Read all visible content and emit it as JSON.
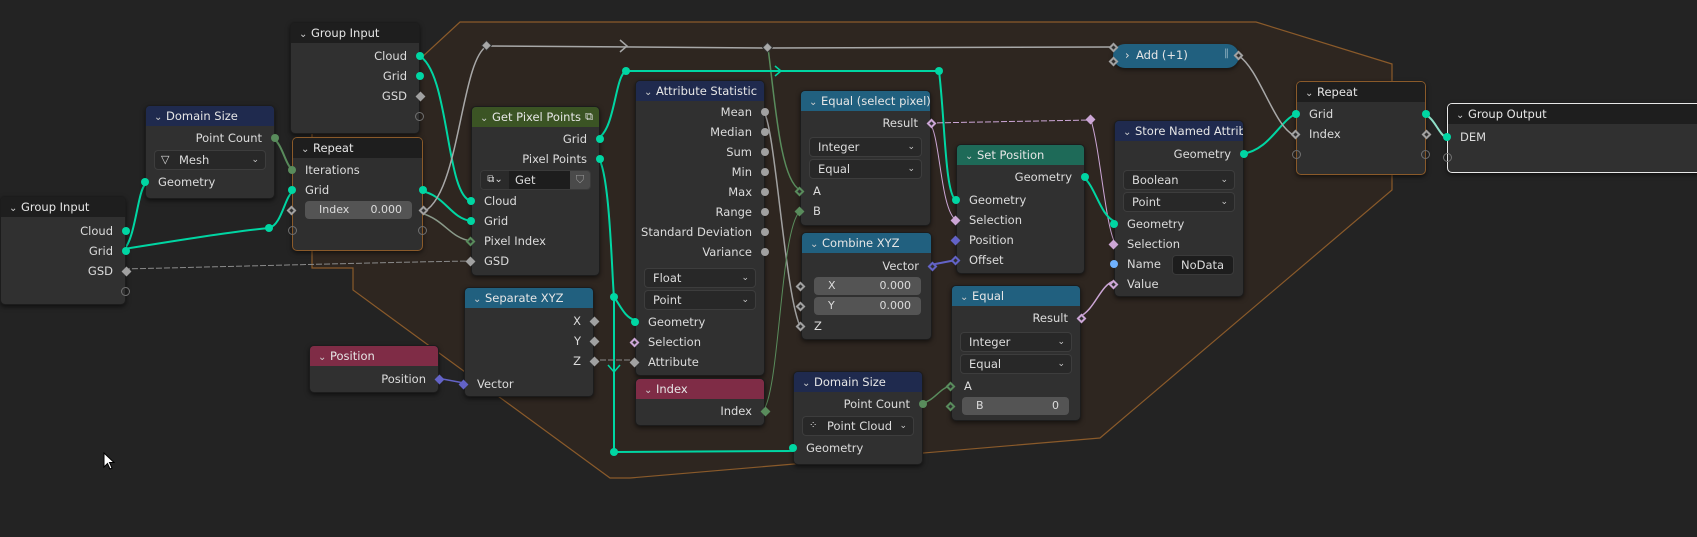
{
  "editor": "Geometry Node Editor",
  "colors": {
    "geometry_socket": "#00d6a3",
    "integer_socket": "#598c5c",
    "float_socket": "#a1a1a1",
    "boolean_socket": "#cca6d6",
    "vector_socket": "#6363c7",
    "string_socket": "#70b2ff",
    "frame_border": "#8a5a2a",
    "frame_fill": "#2e2620"
  },
  "nodes": {
    "group_input_main": {
      "title": "Group Input",
      "outputs": [
        "Cloud",
        "Grid",
        "GSD"
      ]
    },
    "group_input_top": {
      "title": "Group Input",
      "outputs": [
        "Cloud",
        "Grid",
        "GSD"
      ]
    },
    "domain_size_mesh": {
      "title": "Domain Size",
      "outputs": [
        "Point Count"
      ],
      "component": "Mesh",
      "inputs": [
        "Geometry"
      ]
    },
    "repeat_input": {
      "title": "Repeat",
      "inputs": [
        "Iterations",
        "Grid"
      ],
      "index_field": {
        "label": "Index",
        "value": "0.000"
      }
    },
    "get_pixel_points": {
      "title": "Get Pixel Points",
      "outputs": [
        "Grid",
        "Pixel Points"
      ],
      "group_selector": "Get Pixel...",
      "inputs": [
        "Cloud",
        "Grid",
        "Pixel Index",
        "GSD"
      ]
    },
    "attribute_statistic": {
      "title": "Attribute Statistic",
      "outputs": [
        "Mean",
        "Median",
        "Sum",
        "Min",
        "Max",
        "Range",
        "Standard Deviation",
        "Variance"
      ],
      "data_type": "Float",
      "domain": "Point",
      "inputs": [
        "Geometry",
        "Selection",
        "Attribute"
      ]
    },
    "equal_select_pixel": {
      "title": "Equal (select pixel)",
      "outputs": [
        "Result"
      ],
      "data_type": "Integer",
      "mode": "Equal",
      "inputs": [
        "A",
        "B"
      ]
    },
    "combine_xyz": {
      "title": "Combine XYZ",
      "outputs": [
        "Vector"
      ],
      "fields": [
        {
          "label": "X",
          "value": "0.000"
        },
        {
          "label": "Y",
          "value": "0.000"
        }
      ],
      "inputs": [
        "Z"
      ]
    },
    "set_position": {
      "title": "Set Position",
      "outputs": [
        "Geometry"
      ],
      "inputs": [
        "Geometry",
        "Selection",
        "Position",
        "Offset"
      ]
    },
    "equal_b": {
      "title": "Equal",
      "outputs": [
        "Result"
      ],
      "data_type": "Integer",
      "mode": "Equal",
      "inputs": [
        "A"
      ],
      "b_field": {
        "label": "B",
        "value": "0"
      }
    },
    "store_named_attribute": {
      "title": "Store Named Attrib...",
      "outputs": [
        "Geometry"
      ],
      "data_type": "Boolean",
      "domain": "Point",
      "inputs": [
        "Geometry",
        "Selection",
        "Name",
        "Value"
      ],
      "name_value": "NoData"
    },
    "add_one": {
      "title": "Add (+1)"
    },
    "repeat_output": {
      "title": "Repeat",
      "inputs": [
        "Grid",
        "Index"
      ]
    },
    "group_output": {
      "title": "Group Output",
      "inputs": [
        "DEM"
      ]
    },
    "separate_xyz": {
      "title": "Separate XYZ",
      "outputs": [
        "X",
        "Y",
        "Z"
      ],
      "inputs": [
        "Vector"
      ]
    },
    "position": {
      "title": "Position",
      "outputs": [
        "Position"
      ]
    },
    "index": {
      "title": "Index",
      "outputs": [
        "Index"
      ]
    },
    "domain_size_pc": {
      "title": "Domain Size",
      "outputs": [
        "Point Count"
      ],
      "component": "Point Cloud",
      "inputs": [
        "Geometry"
      ]
    }
  },
  "icons": {
    "chevron_down": "⌄",
    "chevron_right": "›",
    "dropdown_arrow": "⌄"
  }
}
